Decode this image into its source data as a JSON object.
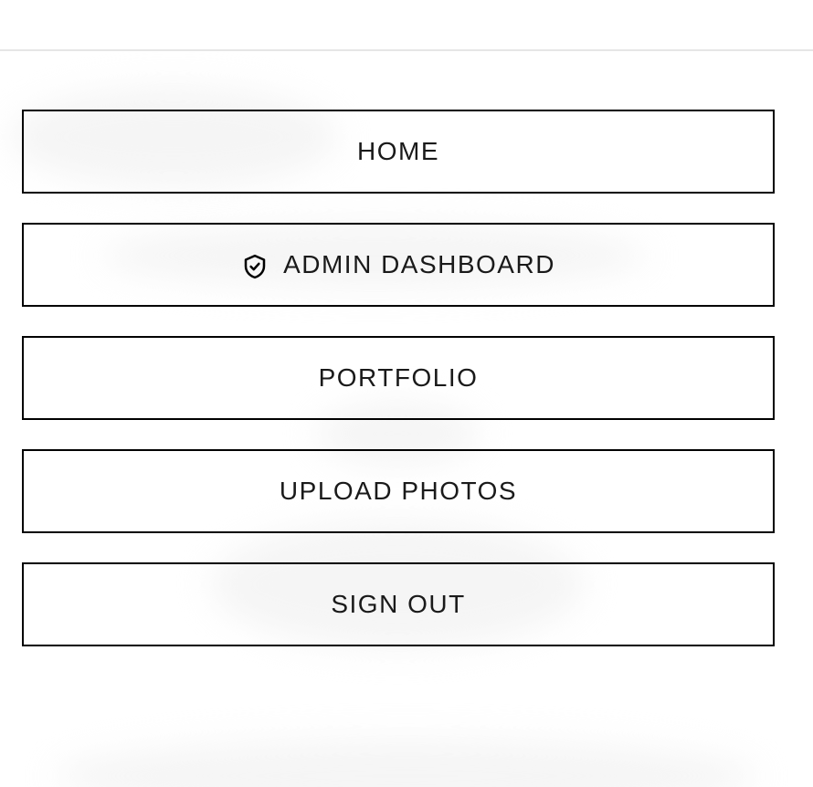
{
  "menu": {
    "items": [
      {
        "label": "HOME",
        "icon": null
      },
      {
        "label": "ADMIN DASHBOARD",
        "icon": "shield-check-icon"
      },
      {
        "label": "PORTFOLIO",
        "icon": null
      },
      {
        "label": "UPLOAD PHOTOS",
        "icon": null
      },
      {
        "label": "SIGN OUT",
        "icon": null
      }
    ]
  },
  "colors": {
    "border": "#000000",
    "text": "#1a1a1a",
    "background": "#ffffff"
  }
}
